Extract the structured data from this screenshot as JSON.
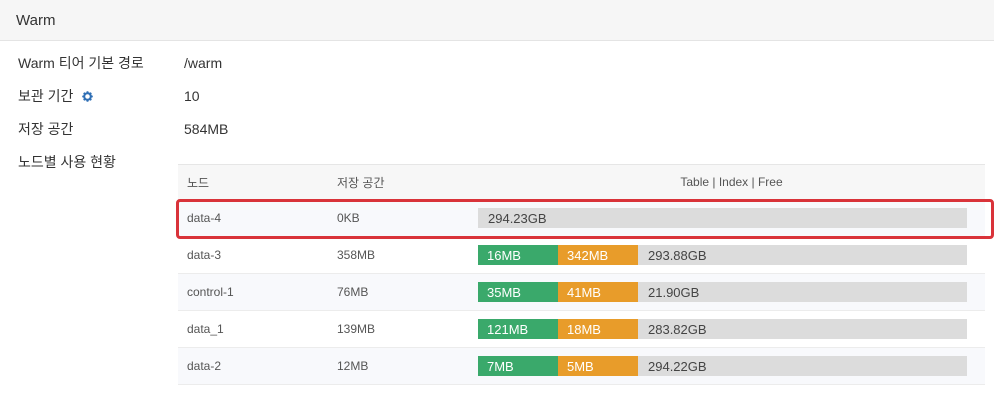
{
  "panel": {
    "title": "Warm"
  },
  "props": {
    "path_label": "Warm 티어 기본 경로",
    "path_value": "/warm",
    "retention_label": "보관 기간",
    "retention_value": "10",
    "storage_label": "저장 공간",
    "storage_value": "584MB",
    "node_usage_label": "노드별 사용 현황"
  },
  "table": {
    "headers": {
      "node": "노드",
      "storage": "저장 공간",
      "usage": "Table | Index | Free"
    },
    "rows": [
      {
        "node": "data-4",
        "storage": "0KB",
        "table": "",
        "index": "",
        "free": "294.23GB"
      },
      {
        "node": "data-3",
        "storage": "358MB",
        "table": "16MB",
        "index": "342MB",
        "free": "293.88GB"
      },
      {
        "node": "control-1",
        "storage": "76MB",
        "table": "35MB",
        "index": "41MB",
        "free": "21.90GB"
      },
      {
        "node": "data_1",
        "storage": "139MB",
        "table": "121MB",
        "index": "18MB",
        "free": "283.82GB"
      },
      {
        "node": "data-2",
        "storage": "12MB",
        "table": "7MB",
        "index": "5MB",
        "free": "294.22GB"
      }
    ]
  },
  "colors": {
    "table": "#3aa96b",
    "index": "#e89c2a",
    "free": "#dcdcdc",
    "highlight": "#d9333a",
    "gear": "#2f6fb5"
  },
  "icons": {
    "retention": "gear-icon"
  }
}
